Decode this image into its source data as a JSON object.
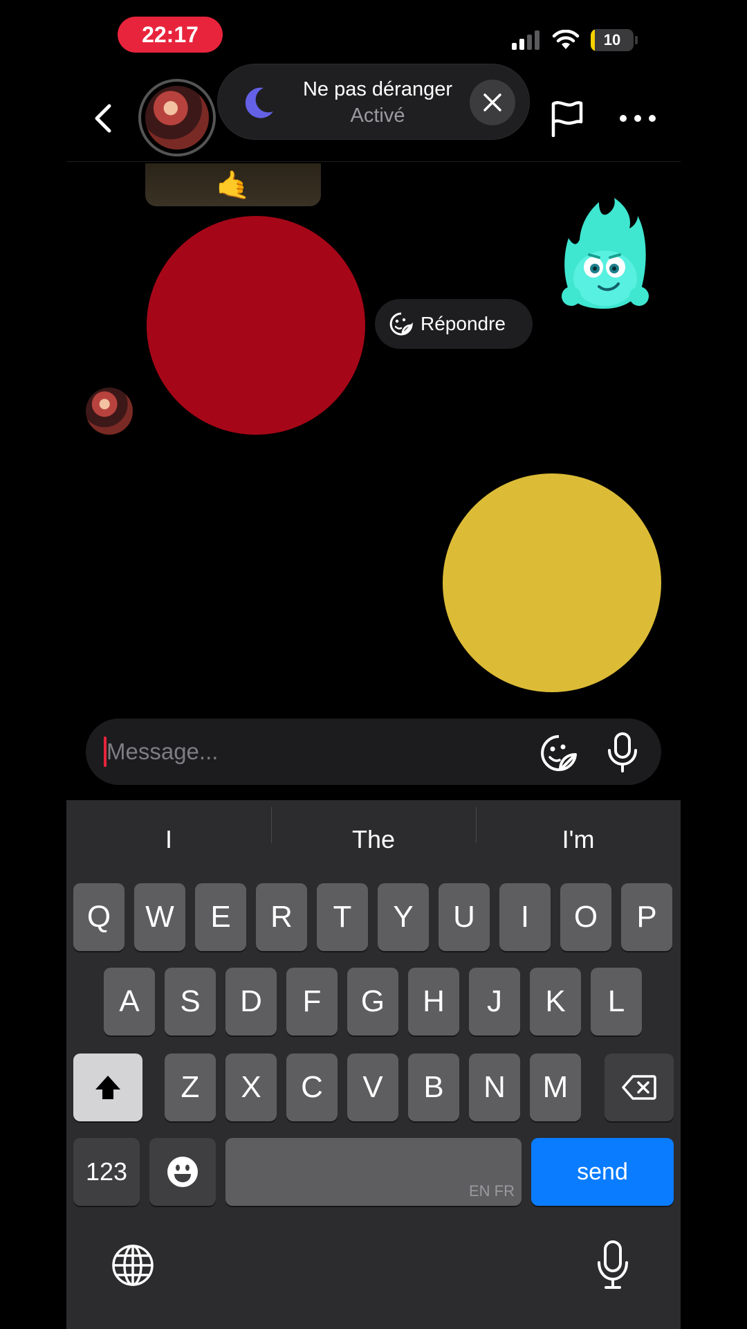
{
  "status_bar": {
    "time": "22:17",
    "battery_level": "10",
    "battery_fraction": 0.1,
    "accent_color": "#e8243c",
    "icons": [
      "signal-icon",
      "wifi-icon",
      "battery-icon"
    ]
  },
  "header": {
    "icons": [
      "back-chevron-icon",
      "flag-icon",
      "more-icon"
    ]
  },
  "dnd_banner": {
    "title": "Ne pas déranger",
    "subtitle": "Activé",
    "icons": [
      "moon-icon",
      "close-icon"
    ]
  },
  "chat": {
    "reply_label": "Répondre",
    "sent_image_emoji": "🤙",
    "red_circle_color": "#a60718",
    "yellow_circle_color": "#dcbc37"
  },
  "composer": {
    "placeholder": "Message...",
    "icons": [
      "sticker-icon",
      "microphone-icon"
    ]
  },
  "keyboard": {
    "suggestions": [
      "I",
      "The",
      "I'm"
    ],
    "row1": [
      "Q",
      "W",
      "E",
      "R",
      "T",
      "Y",
      "U",
      "I",
      "O",
      "P"
    ],
    "row2": [
      "A",
      "S",
      "D",
      "F",
      "G",
      "H",
      "J",
      "K",
      "L"
    ],
    "row3": [
      "Z",
      "X",
      "C",
      "V",
      "B",
      "N",
      "M"
    ],
    "numbers_label": "123",
    "space_languages": "EN FR",
    "send_label": "send",
    "send_color": "#0a7cff"
  }
}
